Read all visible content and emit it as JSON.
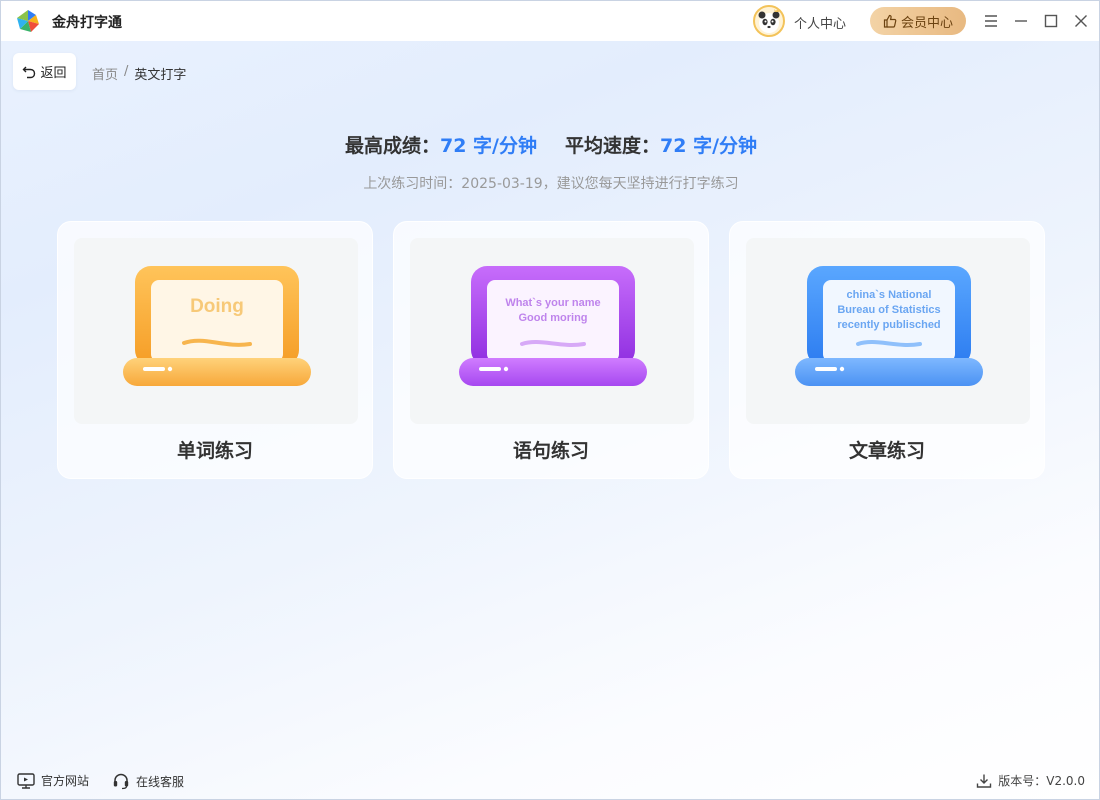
{
  "app": {
    "title": "金舟打字通"
  },
  "header": {
    "profile_label": "个人中心",
    "vip_label": "会员中心"
  },
  "nav": {
    "back_label": "返回",
    "breadcrumb": {
      "home": "首页",
      "separator": "/",
      "current": "英文打字"
    }
  },
  "stats": {
    "best_label": "最高成绩：",
    "best_value": "72 字/分钟",
    "avg_label": "平均速度：",
    "avg_value": "72 字/分钟",
    "subtitle": "上次练习时间：2025-03-19，建议您每天坚持进行打字练习"
  },
  "cards": [
    {
      "label": "单词练习",
      "screen_lines": [
        "Doing"
      ],
      "theme": "#f8a93a"
    },
    {
      "label": "语句练习",
      "screen_lines": [
        "What`s your name",
        "Good moring"
      ],
      "theme": "#a240ec"
    },
    {
      "label": "文章练习",
      "screen_lines": [
        "china`s National",
        "Bureau of Statistics",
        "recently publisched"
      ],
      "theme": "#3d8cf5"
    }
  ],
  "footer": {
    "website_label": "官方网站",
    "service_label": "在线客服",
    "version_label": "版本号：V2.0.0"
  },
  "colors": {
    "accent": "#2f7df6",
    "vip_gold": "#e8b981"
  }
}
